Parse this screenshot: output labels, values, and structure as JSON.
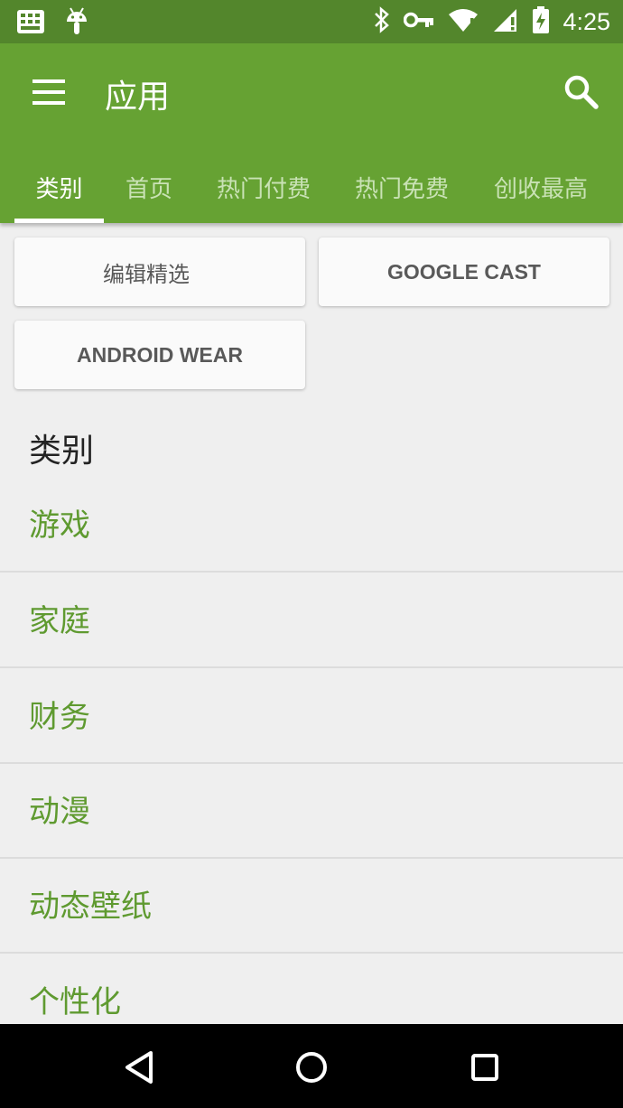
{
  "status_bar": {
    "time": "4:25",
    "left_icons": [
      "keyboard-icon",
      "android-debug-icon"
    ],
    "right_icons": [
      "bluetooth-icon",
      "vpn-key-icon",
      "wifi-icon",
      "cell-signal-icon",
      "battery-charging-icon"
    ]
  },
  "app_bar": {
    "title": "应用",
    "tabs": [
      {
        "label": "类别",
        "active": true
      },
      {
        "label": "首页",
        "active": false
      },
      {
        "label": "热门付费",
        "active": false
      },
      {
        "label": "热门免费",
        "active": false
      },
      {
        "label": "创收最高",
        "active": false
      }
    ]
  },
  "featured_buttons": [
    {
      "label": "编辑精选"
    },
    {
      "label": "GOOGLE CAST"
    },
    {
      "label": "ANDROID WEAR"
    }
  ],
  "categories": {
    "heading": "类别",
    "items": [
      {
        "label": "游戏"
      },
      {
        "label": "家庭"
      },
      {
        "label": "财务"
      },
      {
        "label": "动漫"
      },
      {
        "label": "动态壁纸"
      },
      {
        "label": "个性化"
      }
    ]
  },
  "nav_bar": {
    "buttons": [
      "back-icon",
      "home-icon",
      "recents-icon"
    ]
  },
  "colors": {
    "status_bar": "#53862c",
    "app_bar": "#66a233",
    "accent_text": "#5f9a30",
    "background": "#efefef"
  }
}
